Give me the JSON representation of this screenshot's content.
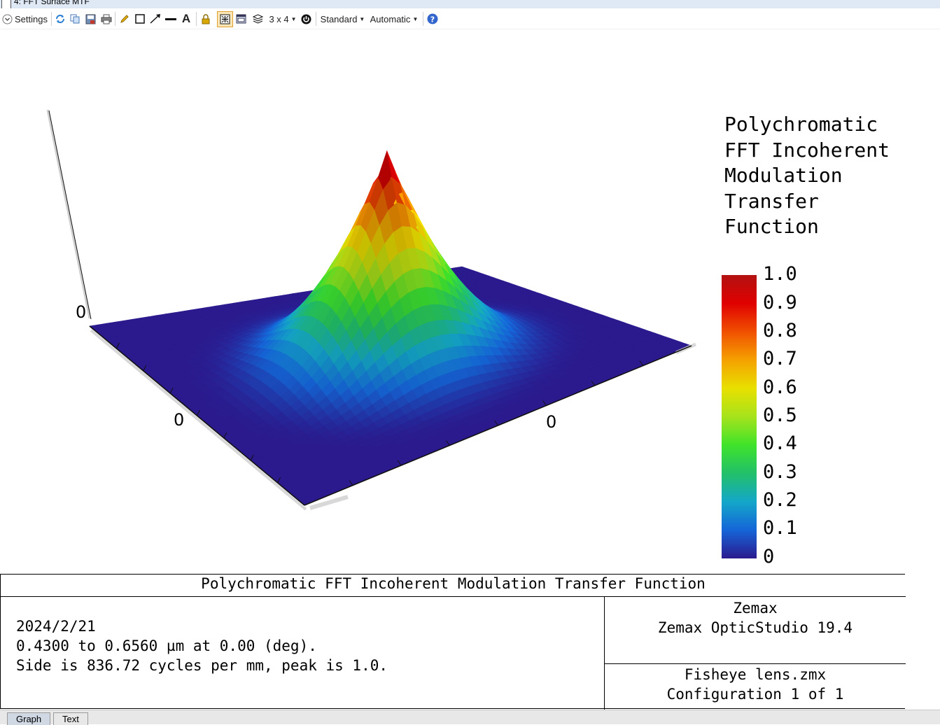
{
  "window": {
    "title": "4: FFT Surface MTF"
  },
  "toolbar": {
    "settings_label": "Settings",
    "layout_label": "3 x 4",
    "standard_label": "Standard",
    "automatic_label": "Automatic"
  },
  "chart_data": {
    "type": "surface-3d",
    "title": "Polychromatic FFT Incoherent Modulation Transfer Function",
    "legend_title_lines": [
      "Polychromatic",
      "FFT Incoherent",
      "Modulation",
      "Transfer",
      "Function"
    ],
    "colorbar_ticks": [
      "1.0",
      "0.9",
      "0.8",
      "0.7",
      "0.6",
      "0.5",
      "0.4",
      "0.3",
      "0.2",
      "0.1",
      "0"
    ],
    "colorbar_range": [
      0,
      1.0
    ],
    "colormap": [
      "#2a1a8e",
      "#1565d8",
      "#14a7c9",
      "#22c06a",
      "#3fe32a",
      "#a6e31c",
      "#e8e000",
      "#f5a100",
      "#f05000",
      "#e00000",
      "#b31212"
    ],
    "axis_labels": {
      "vertical": "0",
      "left": "0",
      "right": "0"
    },
    "surface": {
      "peak": 1.0,
      "base": 0.0,
      "shape": "cone-shaped MTF peak centered on square grid"
    }
  },
  "info": {
    "title": "Polychromatic FFT Incoherent Modulation Transfer Function",
    "left_lines": [
      "2024/2/21",
      "0.4300 to 0.6560 µm at 0.00 (deg).",
      "Side is 836.72 cycles per mm, peak is 1.0."
    ],
    "right_top_lines": [
      "Zemax",
      "Zemax OpticStudio 19.4"
    ],
    "right_bottom_lines": [
      "Fisheye lens.zmx",
      "Configuration 1 of 1"
    ]
  },
  "tabs": [
    {
      "label": "Graph",
      "active": true
    },
    {
      "label": "Text",
      "active": false
    }
  ]
}
